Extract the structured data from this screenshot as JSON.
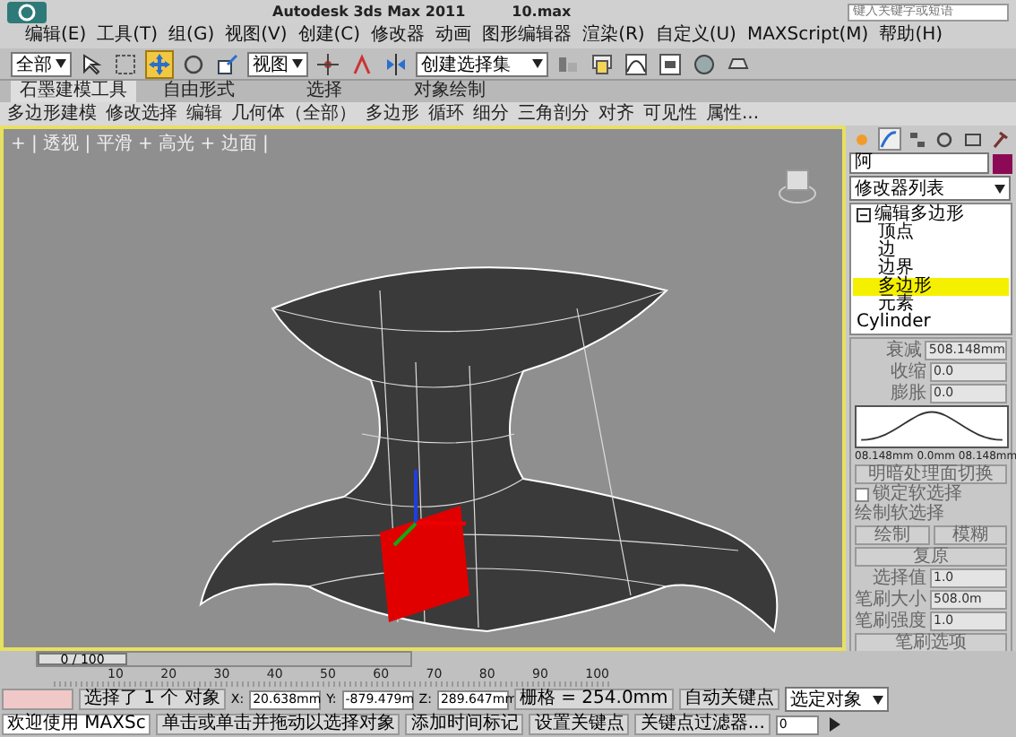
{
  "title_bar": {
    "title": "Autodesk 3ds Max  2011",
    "file": "10.max",
    "search": {
      "placeholder": "键入关键字或短语"
    }
  },
  "menu_bar": {
    "items": [
      "编辑(E)",
      "工具(T)",
      "组(G)",
      "视图(V)",
      "创建(C)",
      "修改器",
      "动画",
      "图形编辑器",
      "渲染(R)",
      "自定义(U)",
      "MAXScript(M)",
      "帮助(H)"
    ]
  },
  "toolbar": {
    "selection_filter": "全部",
    "reference_coord": "视图",
    "named_selection": "创建选择集",
    "tools": [
      {
        "kind": "select",
        "active": false
      },
      {
        "kind": "region",
        "active": false
      },
      {
        "kind": "move",
        "active": true
      },
      {
        "kind": "rotate",
        "active": false
      },
      {
        "kind": "scale",
        "active": false
      },
      {
        "kind": "pivot",
        "active": false
      },
      {
        "kind": "snap",
        "active": false
      },
      {
        "kind": "mirror",
        "active": false
      },
      {
        "kind": "align",
        "active": false
      },
      {
        "kind": "layer",
        "active": false
      },
      {
        "kind": "curve",
        "active": false
      },
      {
        "kind": "schematic",
        "active": false
      },
      {
        "kind": "material",
        "active": false
      },
      {
        "kind": "render",
        "active": false
      }
    ]
  },
  "ribbon": {
    "tabs": [
      {
        "label": "石墨建模工具",
        "selected": true
      },
      {
        "label": "自由形式",
        "selected": false
      },
      {
        "label": "选择",
        "selected": false
      },
      {
        "label": "对象绘制",
        "selected": false
      }
    ],
    "items": [
      "多边形建模",
      "修改选择",
      "编辑",
      "几何体（全部）",
      "多边形",
      "循环",
      "细分",
      "三角剖分",
      "对齐",
      "可见性",
      "属性..."
    ]
  },
  "viewport": {
    "label": "+ | 透视 | 平滑 + 高光 + 边面 |",
    "active": true
  },
  "command_panel": {
    "tabs": [
      {
        "kind": "create",
        "selected": false
      },
      {
        "kind": "modify",
        "selected": true
      },
      {
        "kind": "hierarchy",
        "selected": false
      },
      {
        "kind": "motion",
        "selected": false
      },
      {
        "kind": "display",
        "selected": false
      },
      {
        "kind": "utilities",
        "selected": false
      }
    ],
    "object_name": "阿",
    "modifier_list": "修改器列表",
    "stack": [
      {
        "label": "编辑多边形",
        "expanded": true,
        "children": [
          {
            "label": "顶点",
            "selected": false
          },
          {
            "label": "边",
            "selected": false
          },
          {
            "label": "边界",
            "selected": false
          },
          {
            "label": "多边形",
            "selected": true
          },
          {
            "label": "元素",
            "selected": false
          }
        ]
      },
      {
        "label": "Cylinder"
      }
    ],
    "soft_selection": {
      "fields": [
        {
          "label": "衰减",
          "value": "508.148mm"
        },
        {
          "label": "收缩",
          "value": "0.0"
        },
        {
          "label": "膨胀",
          "value": "0.0"
        }
      ],
      "curve_labels": [
        "08.148mm",
        "0.0mm",
        "08.148mm"
      ],
      "shade_button": "明暗处理面切换",
      "lock": {
        "label": "锁定软选择",
        "checked": false
      },
      "paint": {
        "title": "绘制软选择",
        "buttons": [
          "绘制",
          "模糊"
        ],
        "revert": "复原",
        "fields": [
          {
            "label": "选择值",
            "value": "1.0"
          },
          {
            "label": "笔刷大小",
            "value": "508.0m"
          },
          {
            "label": "笔刷强度",
            "value": "1.0"
          }
        ],
        "options": "笔刷选项"
      }
    }
  },
  "timeline": {
    "frame": "0 / 100",
    "level": 0,
    "ticks": [
      "10",
      "20",
      "30",
      "40",
      "50",
      "60",
      "70",
      "80",
      "90",
      "100"
    ]
  },
  "status": {
    "maxscript": "欢迎使用 MAXSc",
    "selection": "选择了 1 个 对象",
    "prompt": "单击或单击并拖动以选择对象",
    "coords": [
      {
        "axis": "X:",
        "value": "20.638mm"
      },
      {
        "axis": "Y:",
        "value": "-879.479m"
      },
      {
        "axis": "Z:",
        "value": "289.647mm"
      }
    ],
    "grid": "栅格 = 254.0mm",
    "time_tag": "添加时间标记",
    "auto_key": "自动关键点",
    "key_target": "选定对象",
    "set_key": "设置关键点",
    "key_filters": "关键点过滤器...",
    "frame": "0"
  }
}
